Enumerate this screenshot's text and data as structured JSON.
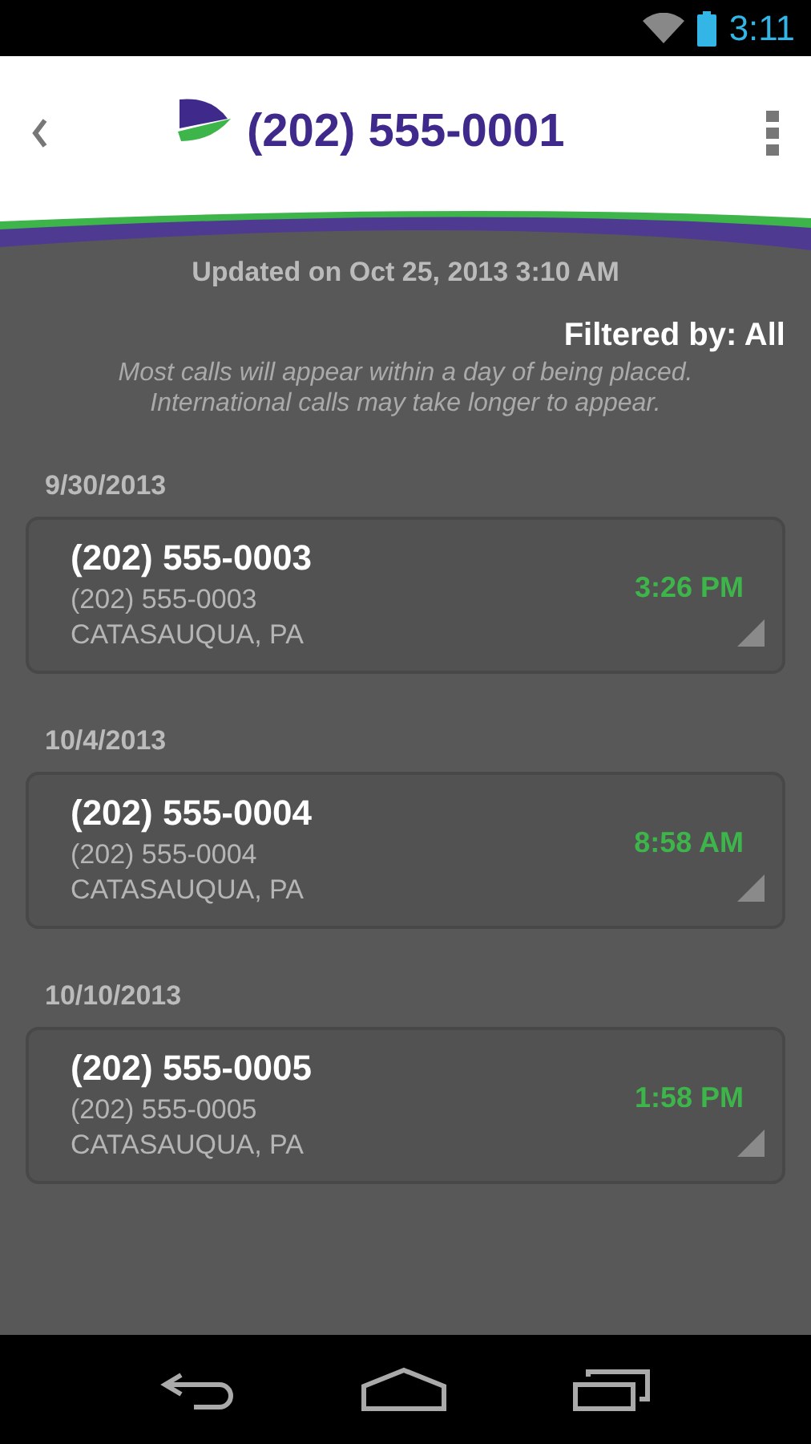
{
  "status_bar": {
    "time": "3:11"
  },
  "header": {
    "title": "(202) 555-0001"
  },
  "updated": "Updated on Oct 25, 2013 3:10 AM",
  "filter": "Filtered by: All",
  "note": "Most calls will appear within a day of being placed. International calls may take longer to appear.",
  "calls": [
    {
      "date": "9/30/2013",
      "name": "(202) 555-0003",
      "number": "(202) 555-0003",
      "location": "CATASAUQUA, PA",
      "time": "3:26 PM"
    },
    {
      "date": "10/4/2013",
      "name": "(202) 555-0004",
      "number": "(202) 555-0004",
      "location": "CATASAUQUA, PA",
      "time": "8:58 AM"
    },
    {
      "date": "10/10/2013",
      "name": "(202) 555-0005",
      "number": "(202) 555-0005",
      "location": "CATASAUQUA, PA",
      "time": "1:58 PM"
    }
  ]
}
